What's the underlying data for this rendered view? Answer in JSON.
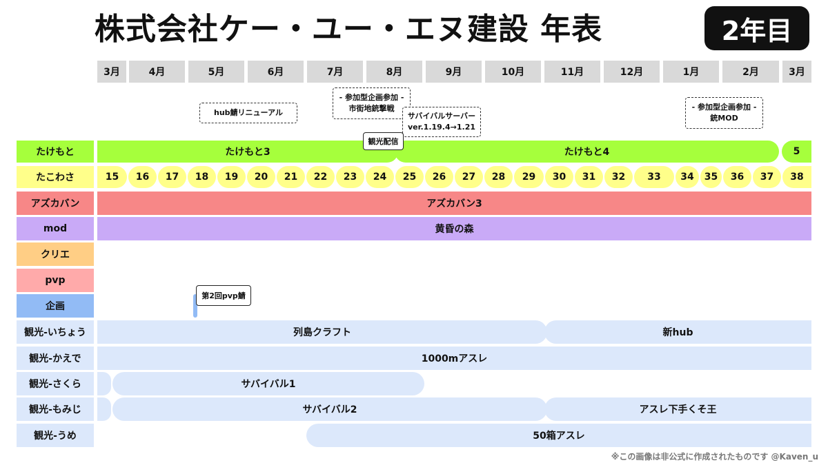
{
  "title": "株式会社ケー・ユー・エヌ建設 年表",
  "year_badge": "2年目",
  "months": [
    "3月",
    "4月",
    "5月",
    "6月",
    "7月",
    "8月",
    "9月",
    "10月",
    "11月",
    "12月",
    "1月",
    "2月",
    "3月"
  ],
  "events": {
    "hub_renewal": "hub鯖リニューアル",
    "collab1_line1": "- 参加型企画参加 -",
    "collab1_line2": "市街地銃撃戦",
    "survival_server_line1": "サバイバルサーバー",
    "survival_server_line2": "ver.1.19.4→1.21",
    "collab2_line1": "- 参加型企画参加 -",
    "collab2_line2": "銃MOD",
    "tour_stream": "観光配信",
    "pvp_server2": "第2回pvp鯖"
  },
  "rows": {
    "takemoto": {
      "label": "たけもと",
      "bar1": "たけもと3",
      "bar2": "たけもと4",
      "bar3": "5"
    },
    "takowasa": {
      "label": "たこわさ",
      "numbers": [
        "15",
        "16",
        "17",
        "18",
        "19",
        "20",
        "21",
        "22",
        "23",
        "24",
        "25",
        "26",
        "27",
        "28",
        "29",
        "30",
        "31",
        "32",
        "33",
        "34",
        "35",
        "36",
        "37",
        "38"
      ]
    },
    "azkaban": {
      "label": "アズカバン",
      "bar": "アズカバン3"
    },
    "mod": {
      "label": "mod",
      "bar": "黄昏の森"
    },
    "creative": {
      "label": "クリエ"
    },
    "pvp": {
      "label": "pvp"
    },
    "project": {
      "label": "企画"
    },
    "ichou": {
      "label": "観光-いちょう",
      "bar1": "列島クラフト",
      "bar2": "新hub"
    },
    "kaede": {
      "label": "観光-かえで",
      "bar": "1000mアスレ"
    },
    "sakura": {
      "label": "観光-さくら",
      "bar": "サバイバル1"
    },
    "momiji": {
      "label": "観光-もみじ",
      "bar1": "サバイバル2",
      "bar2": "アスレ下手くそ王"
    },
    "ume": {
      "label": "観光-うめ",
      "bar": "50箱アスレ"
    }
  },
  "footer": "※この画像は非公式に作成されたものです @Kaven_u",
  "colors": {
    "takemoto": "#a6ff3c",
    "takowasa": "#ffff8a",
    "azkaban": "#f78787",
    "mod": "#c9aaf7",
    "creative": "#ffce85",
    "pvp": "#ffaaaa",
    "project": "#92bbf5",
    "tourism": "#dce8fb",
    "month": "#d9d9d9"
  }
}
